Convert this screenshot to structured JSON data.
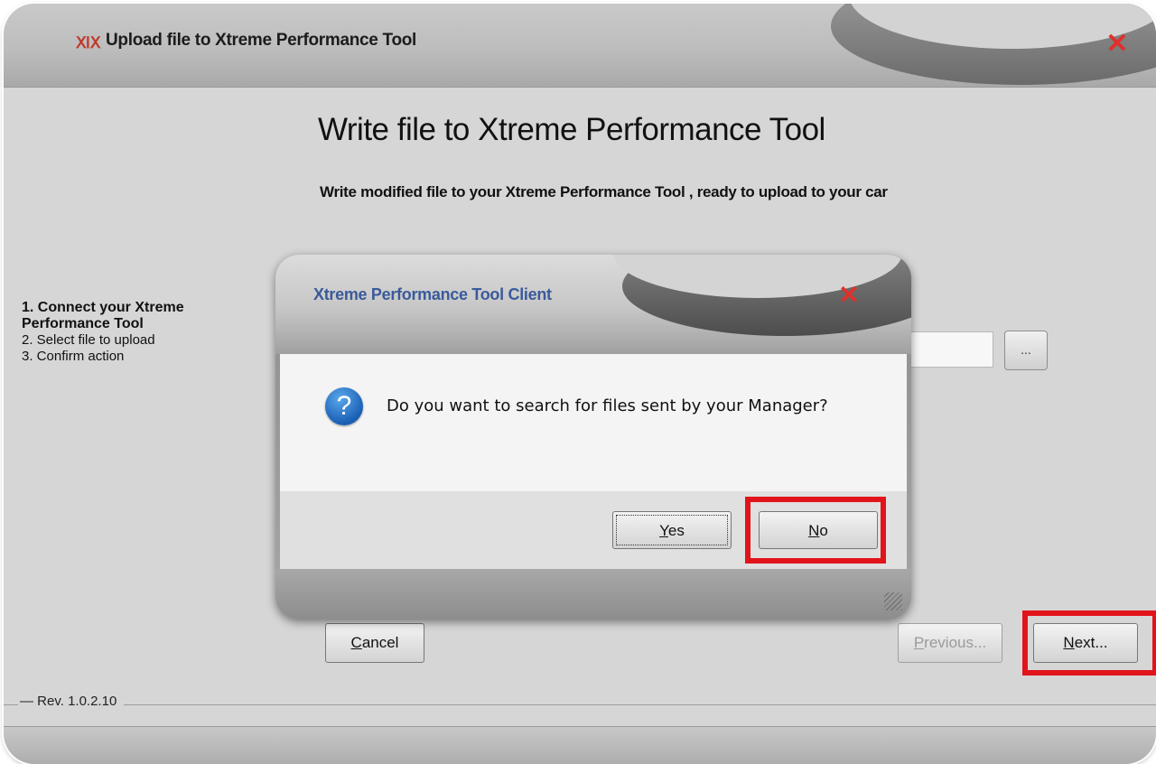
{
  "window": {
    "title": "Upload file to Xtreme Performance Tool",
    "title_icon": "xpt-logo-icon",
    "close_icon": "close-icon",
    "close_glyph": "✕"
  },
  "page": {
    "heading": "Write file to Xtreme Performance Tool",
    "subheading": "Write modified file to your Xtreme Performance Tool , ready to upload to your car"
  },
  "steps": [
    {
      "label": "1. Connect your Xtreme Performance Tool",
      "active": true
    },
    {
      "label": "2. Select file to upload",
      "active": false
    },
    {
      "label": "3. Confirm action",
      "active": false
    }
  ],
  "file_field": {
    "value": "",
    "browse_label": "..."
  },
  "buttons": {
    "cancel": {
      "label_underlined": "C",
      "label_rest": "ancel"
    },
    "previous": {
      "label_underlined": "P",
      "label_rest": "revious..."
    },
    "next": {
      "label_underlined": "N",
      "label_rest": "ext..."
    }
  },
  "revision": "Rev. 1.0.2.10",
  "dialog": {
    "title": "Xtreme Performance Tool Client",
    "close_glyph": "✕",
    "icon": "question-icon",
    "icon_glyph": "?",
    "message": "Do you want to search for files sent by your Manager?",
    "yes": {
      "label_underlined": "Y",
      "label_rest": "es"
    },
    "no": {
      "label_underlined": "N",
      "label_rest": "o"
    }
  },
  "colors": {
    "highlight": "#e1141b",
    "dialog_title": "#3a5a9a",
    "close": "#e0302b"
  }
}
